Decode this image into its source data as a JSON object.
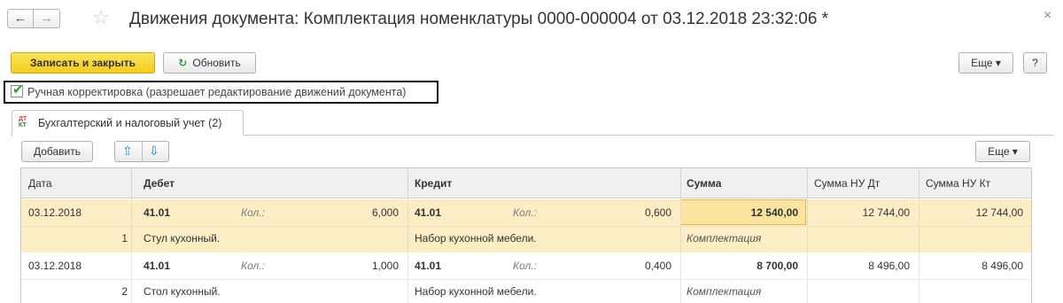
{
  "window": {
    "back_label": "←",
    "forward_label": "→",
    "star_glyph": "☆",
    "title": "Движения документа: Комплектация номенклатуры 0000-000004 от 03.12.2018 23:32:06 *",
    "close_glyph": "×"
  },
  "toolbar": {
    "save_close_label": "Записать и закрыть",
    "refresh_icon": "↻",
    "refresh_label": "Обновить",
    "more_label": "Еще ▾",
    "help_label": "?"
  },
  "manual_correction": {
    "checked": true,
    "check_glyph": "✔",
    "label": "Ручная корректировка (разрешает редактирование движений документа)"
  },
  "tab": {
    "icon_top": "ДТ",
    "icon_bottom": "КТ",
    "label": "Бухгалтерский и налоговый учет (2)"
  },
  "table_toolbar": {
    "add_label": "Добавить",
    "up_glyph": "⇧",
    "down_glyph": "⇩",
    "more_label": "Еще ▾"
  },
  "columns": {
    "date": "Дата",
    "debit": "Дебет",
    "credit": "Кредит",
    "amount": "Сумма",
    "amount_nu_dt": "Сумма НУ Дт",
    "amount_nu_kt": "Сумма НУ Кт"
  },
  "rows": [
    {
      "date": "03.12.2018",
      "num": "1",
      "debit_account": "41.01",
      "debit_qty_label": "Кол.:",
      "debit_qty": "6,000",
      "debit_subconto": "Стул кухонный.",
      "credit_account": "41.01",
      "credit_qty_label": "Кол.:",
      "credit_qty": "0,600",
      "credit_subconto": "Набор кухонной мебели.",
      "amount": "12 540,00",
      "content": "Комплектация",
      "amount_nu_dt": "12 744,00",
      "amount_nu_kt": "12 744,00"
    },
    {
      "date": "03.12.2018",
      "num": "2",
      "debit_account": "41.01",
      "debit_qty_label": "Кол.:",
      "debit_qty": "1,000",
      "debit_subconto": "Стол кухонный.",
      "credit_account": "41.01",
      "credit_qty_label": "Кол.:",
      "credit_qty": "0,400",
      "credit_subconto": "Набор кухонной мебели.",
      "amount": "8 700,00",
      "content": "Комплектация",
      "amount_nu_dt": "8 496,00",
      "amount_nu_kt": "8 496,00"
    }
  ]
}
